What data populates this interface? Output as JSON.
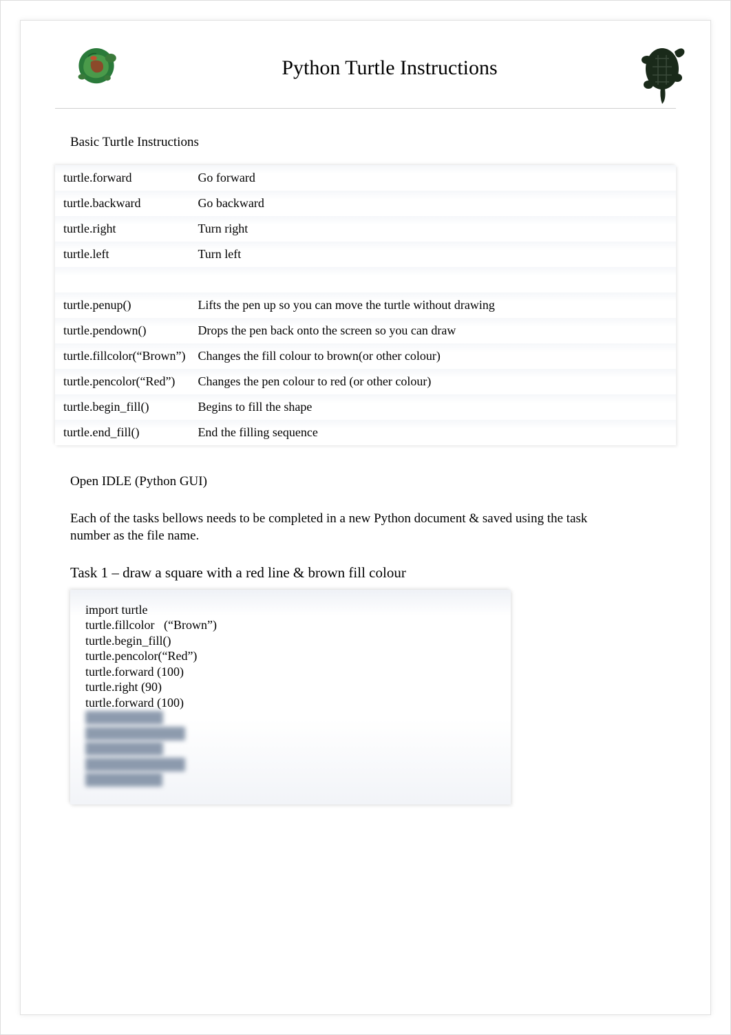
{
  "header": {
    "title": "Python Turtle Instructions"
  },
  "section_heading": "Basic Turtle Instructions",
  "instructions": {
    "group1": [
      {
        "cmd": "turtle.forward",
        "desc": "Go forward"
      },
      {
        "cmd": "turtle.backward",
        "desc": "Go backward"
      },
      {
        "cmd": "turtle.right",
        "desc": "Turn right"
      },
      {
        "cmd": "turtle.left",
        "desc": "Turn left"
      }
    ],
    "group2": [
      {
        "cmd": "turtle.penup()",
        "desc": "Lifts the pen up so you can move the turtle without drawing"
      },
      {
        "cmd": "turtle.pendown()",
        "desc": "Drops the pen back onto the screen so you can draw"
      },
      {
        "cmd": "turtle.fillcolor(“Brown”)",
        "desc": "Changes the fill colour to brown(or other colour)"
      },
      {
        "cmd": "turtle.pencolor(“Red”)",
        "desc": "Changes the pen colour to red (or other colour)"
      },
      {
        "cmd": "turtle.begin_fill()",
        "desc": "Begins to fill the shape"
      },
      {
        "cmd": "turtle.end_fill()",
        "desc": "End the filling sequence"
      }
    ]
  },
  "body_text_1": "Open  IDLE (Python GUI)",
  "body_text_2": "Each of the tasks bellows needs to be completed in a new Python document & saved using the task number as the file name.",
  "task1": {
    "heading": "Task 1   –  draw a square with a red line & brown fill colour",
    "code_lines": [
      "import turtle",
      "turtle.fillcolor   (“Brown”)",
      "turtle.begin_fill()",
      "turtle.pencolor(“Red”)",
      "turtle.forward (100)",
      "turtle.right (90)",
      "turtle.forward (100)"
    ],
    "blurred_lines": [
      "turtle.right (90)",
      "turtle.forward (100)",
      "turtle.right (90)",
      "turtle.forward (100)",
      "turtle.end_fill()"
    ]
  }
}
